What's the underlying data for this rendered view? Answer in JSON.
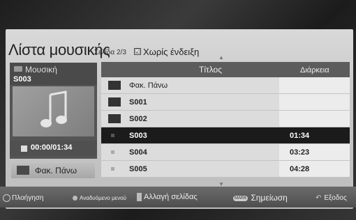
{
  "header": {
    "title": "Λίστα μουσικής",
    "page_indicator": "Σελίδα 2/3",
    "no_preview_checkbox_mark": "☑",
    "no_preview_label": "Χωρίς ένδειξη"
  },
  "preview": {
    "category_label": "Μουσική",
    "file_label": "S003",
    "time": "00:00/01:34",
    "folder_up_label": "Φακ. Πάνω"
  },
  "table": {
    "columns": [
      "Τίτλος",
      "Διάρκεια"
    ],
    "rows": [
      {
        "name": "Φακ. Πάνω",
        "type": "folder",
        "duration": ""
      },
      {
        "name": "S001",
        "type": "folder",
        "duration": ""
      },
      {
        "name": "S002",
        "type": "folder",
        "duration": ""
      },
      {
        "name": "S003",
        "type": "file",
        "duration": "01:34",
        "selected": true
      },
      {
        "name": "S004",
        "type": "file",
        "duration": "03:23"
      },
      {
        "name": "S005",
        "type": "file",
        "duration": "04:28"
      }
    ]
  },
  "footer": {
    "navigation": "Πλοήγηση",
    "popup_menu": "Αναδυόμενο μενού",
    "page_change": "Αλλαγή σελίδας",
    "mark_key": "MARK",
    "mark": "Σημείωση",
    "exit": "Εξοδος"
  },
  "icons": {
    "music": "music-note-icon",
    "folder": "folder-icon",
    "file": "file-icon",
    "stop": "stop-icon"
  }
}
